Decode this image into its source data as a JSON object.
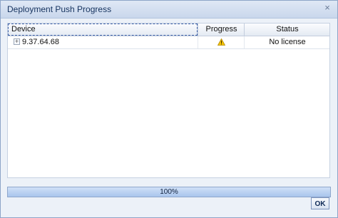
{
  "dialog": {
    "title": "Deployment Push Progress",
    "close_glyph": "×"
  },
  "table": {
    "columns": [
      "Device",
      "Progress",
      "Status"
    ],
    "rows": [
      {
        "device": "9.37.64.68",
        "progress_icon": "warning-icon",
        "status": "No license"
      }
    ],
    "expander_glyph": "+"
  },
  "progress": {
    "value_percent": 100,
    "label": "100%"
  },
  "buttons": {
    "ok_label": "OK"
  },
  "colors": {
    "title_text": "#15325e",
    "warning_fill": "#f5c400",
    "progress_fill": "#a9c5ec"
  }
}
